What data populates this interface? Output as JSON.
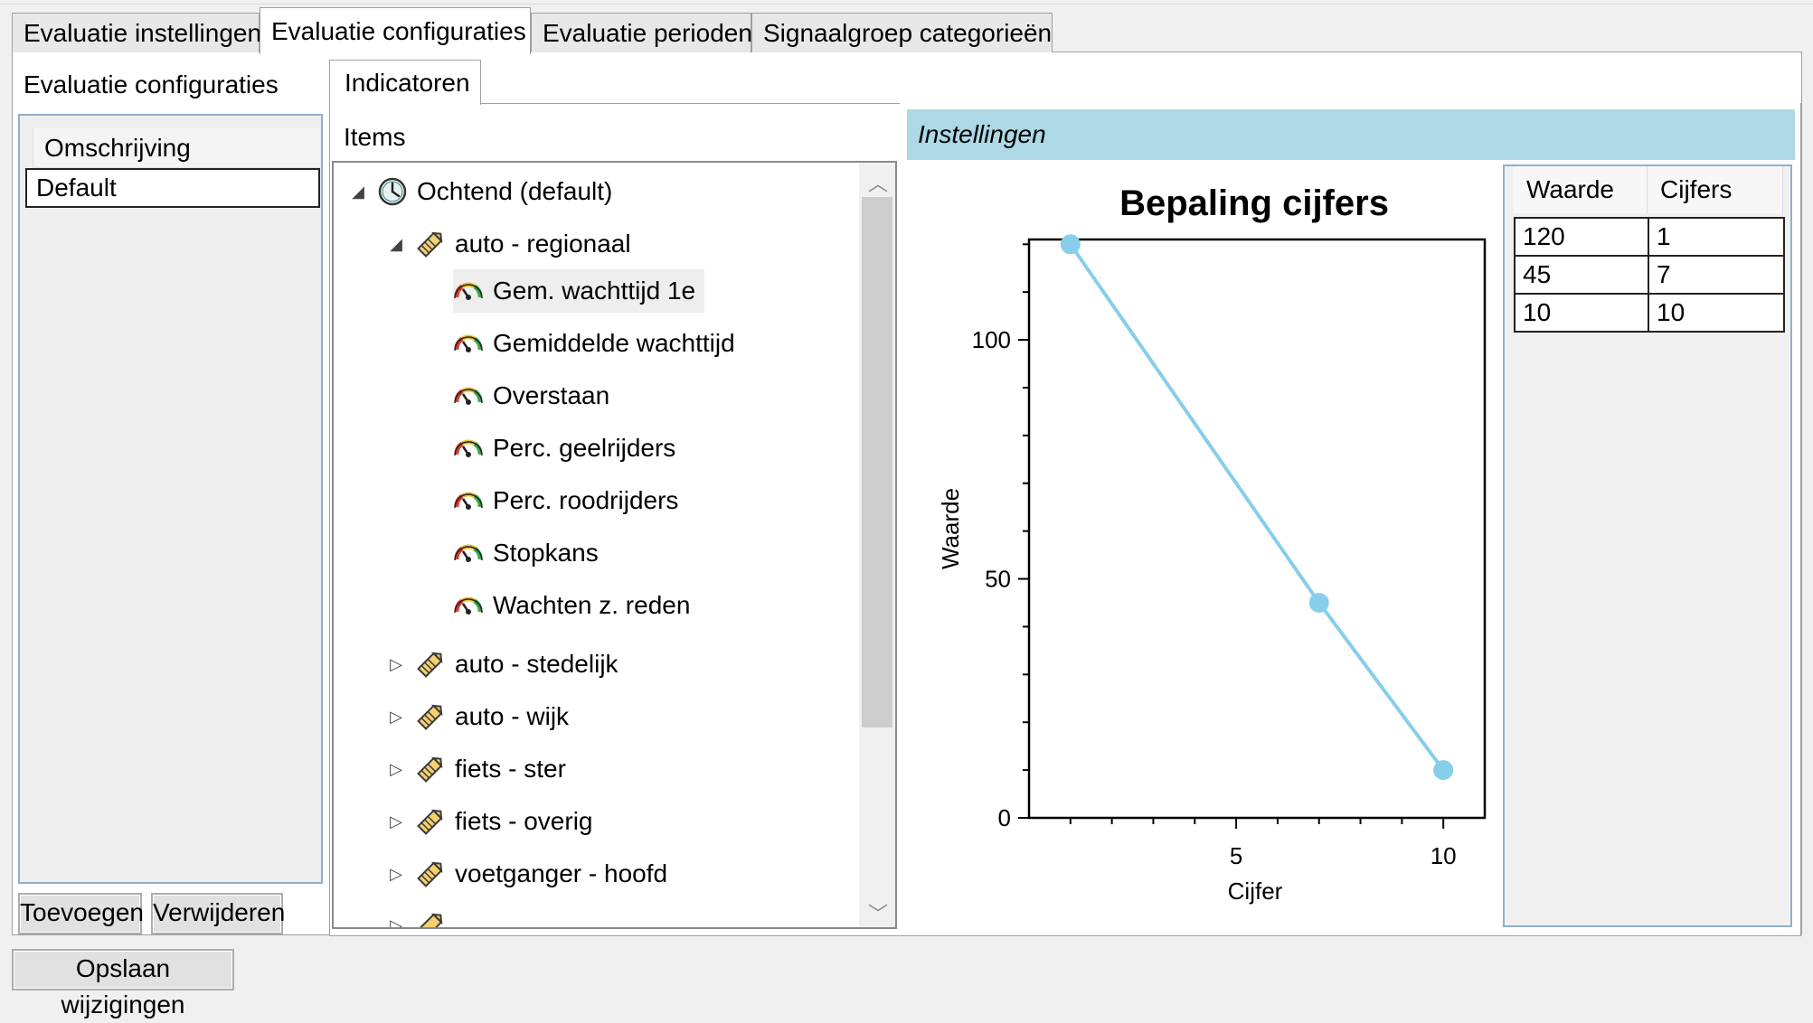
{
  "tabs": [
    {
      "label": "Evaluatie instellingen",
      "active": false
    },
    {
      "label": "Evaluatie configuraties",
      "active": true
    },
    {
      "label": "Evaluatie perioden",
      "active": false
    },
    {
      "label": "Signaalgroep categorieën",
      "active": false
    }
  ],
  "left_panel": {
    "title": "Evaluatie configuraties",
    "column_header": "Omschrijving",
    "rows": [
      "Default"
    ],
    "add_button": "Toevoegen",
    "remove_button": "Verwijderen"
  },
  "save_button": "Opslaan wijzigingen",
  "inner_tab": "Indicatoren",
  "items_label": "Items",
  "tree": {
    "root": "Ochtend  (default)",
    "expanded_group": "auto - regionaal",
    "indicators": [
      "Gem. wachttijd 1e",
      "Gemiddelde wachttijd",
      "Overstaan",
      "Perc. geelrijders",
      "Perc. roodrijders",
      "Stopkans",
      "Wachten z. reden"
    ],
    "collapsed_groups": [
      "auto - stedelijk",
      "auto - wijk",
      "fiets - ster",
      "fiets - overig",
      "voetganger - hoofd"
    ]
  },
  "settings_header": "Instellingen",
  "chart_data": {
    "type": "line",
    "title": "Bepaling cijfers",
    "xlabel": "Cijfer",
    "ylabel": "Waarde",
    "x": [
      1,
      7,
      10
    ],
    "y": [
      120,
      45,
      10
    ],
    "xlim": [
      0,
      11
    ],
    "ylim": [
      0,
      121
    ],
    "xticks_labeled": [
      5,
      10
    ],
    "yticks_labeled": [
      0,
      50,
      100
    ],
    "color": "#87ceeb"
  },
  "grid": {
    "headers": [
      "Waarde",
      "Cijfers"
    ],
    "rows": [
      [
        "120",
        "1"
      ],
      [
        "45",
        "7"
      ],
      [
        "10",
        "10"
      ]
    ]
  }
}
